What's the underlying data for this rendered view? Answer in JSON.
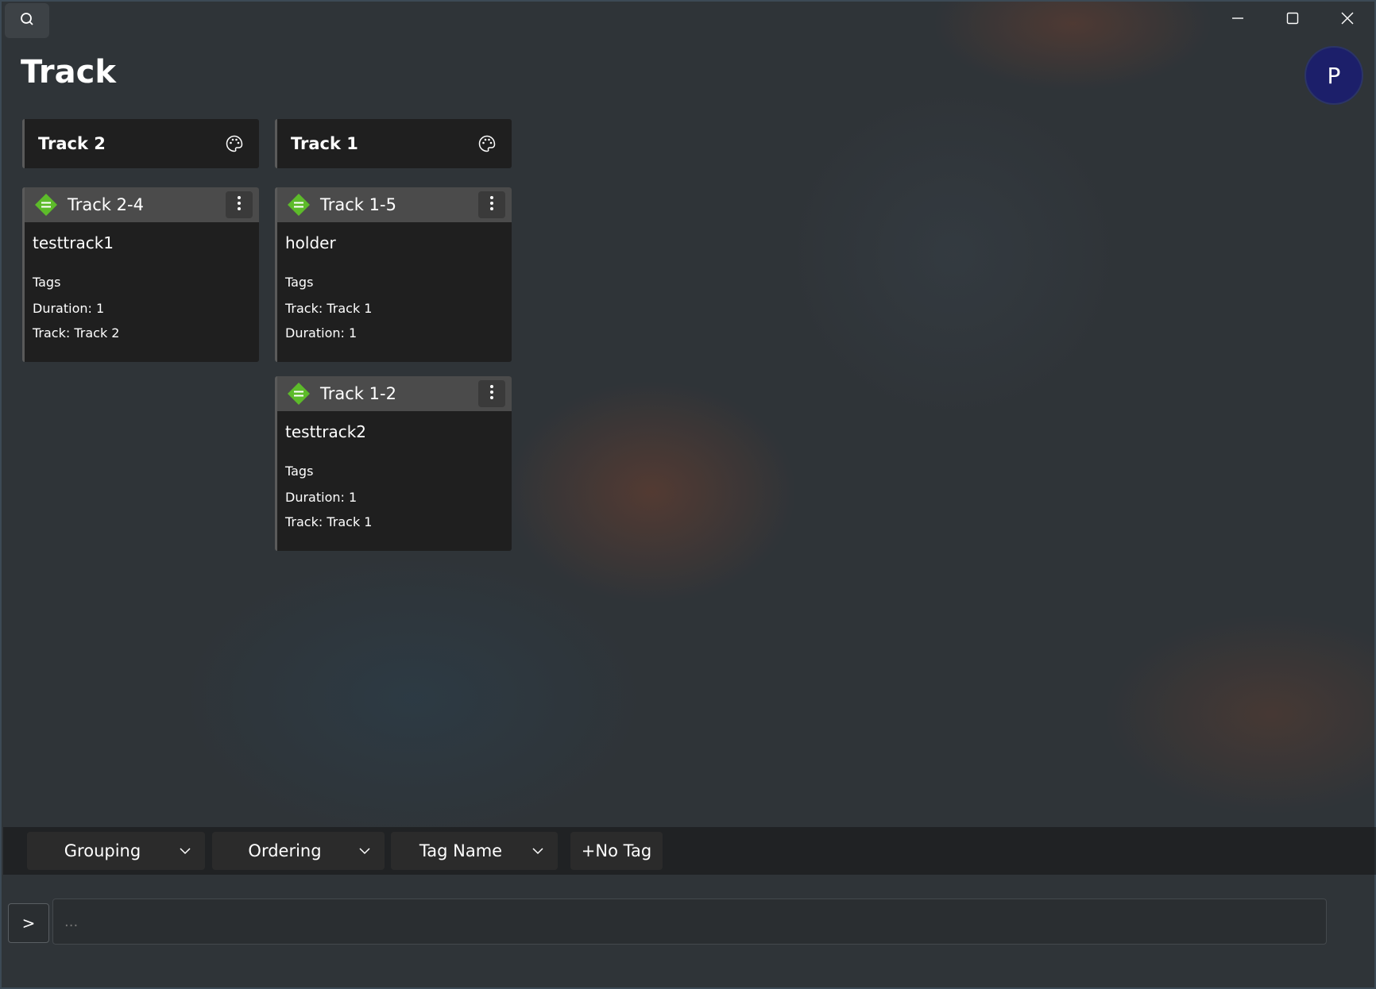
{
  "titlebar": {
    "search_icon": "search-icon",
    "minimize_icon": "minimize-icon",
    "maximize_icon": "maximize-icon",
    "close_icon": "close-icon"
  },
  "page": {
    "title": "Track"
  },
  "user": {
    "avatar_initial": "P",
    "avatar_color": "#1c1f6a"
  },
  "columns": [
    {
      "title": "Track 2",
      "cards": [
        {
          "title": "Track 2-4",
          "name": "testtrack1",
          "tags_label": "Tags",
          "lines": [
            "Duration: 1",
            "Track: Track 2"
          ]
        }
      ]
    },
    {
      "title": "Track 1",
      "cards": [
        {
          "title": "Track 1-5",
          "name": "holder",
          "tags_label": "Tags",
          "lines": [
            "Track: Track 1",
            "Duration: 1"
          ]
        },
        {
          "title": "Track 1-2",
          "name": "testtrack2",
          "tags_label": "Tags",
          "lines": [
            "Duration: 1",
            "Track: Track 1"
          ]
        }
      ]
    }
  ],
  "toolbar": {
    "grouping": "Grouping",
    "ordering": "Ordering",
    "tag_name": "Tag Name",
    "no_tag": "+No Tag"
  },
  "command": {
    "prompt_label": ">",
    "placeholder": "..."
  },
  "colors": {
    "priority_icon": "#5dbb2a",
    "card_header": "#4b4b4b",
    "card_body": "#1f1f1f"
  }
}
